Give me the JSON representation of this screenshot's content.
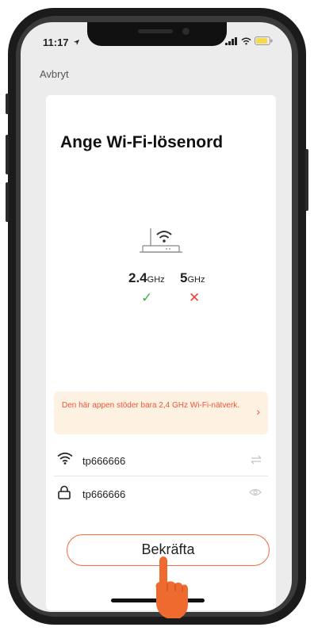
{
  "status": {
    "time": "11:17"
  },
  "nav": {
    "cancel_label": "Avbryt"
  },
  "page": {
    "title": "Ange Wi-Fi-lösenord"
  },
  "bands": [
    {
      "freq": "2.4",
      "unit": "GHz",
      "supported": true,
      "mark": "✓",
      "color": "#39b54a"
    },
    {
      "freq": "5",
      "unit": "GHz",
      "supported": false,
      "mark": "✕",
      "color": "#e8433a"
    }
  ],
  "notice": {
    "text": "Den här appen stöder bara 2,4 GHz Wi-Fi-nätverk.",
    "arrow": "›"
  },
  "wifi_field": {
    "value": "tp666666",
    "icon": "wifi-icon",
    "action_icon": "swap-icon"
  },
  "password_field": {
    "value": "tp666666",
    "icon": "lock-icon",
    "action_icon": "eye-icon"
  },
  "confirm": {
    "label": "Bekräfta"
  },
  "colors": {
    "accent": "#f26a3d",
    "notice_bg": "#fdf1e1",
    "notice_text": "#f0553a"
  }
}
